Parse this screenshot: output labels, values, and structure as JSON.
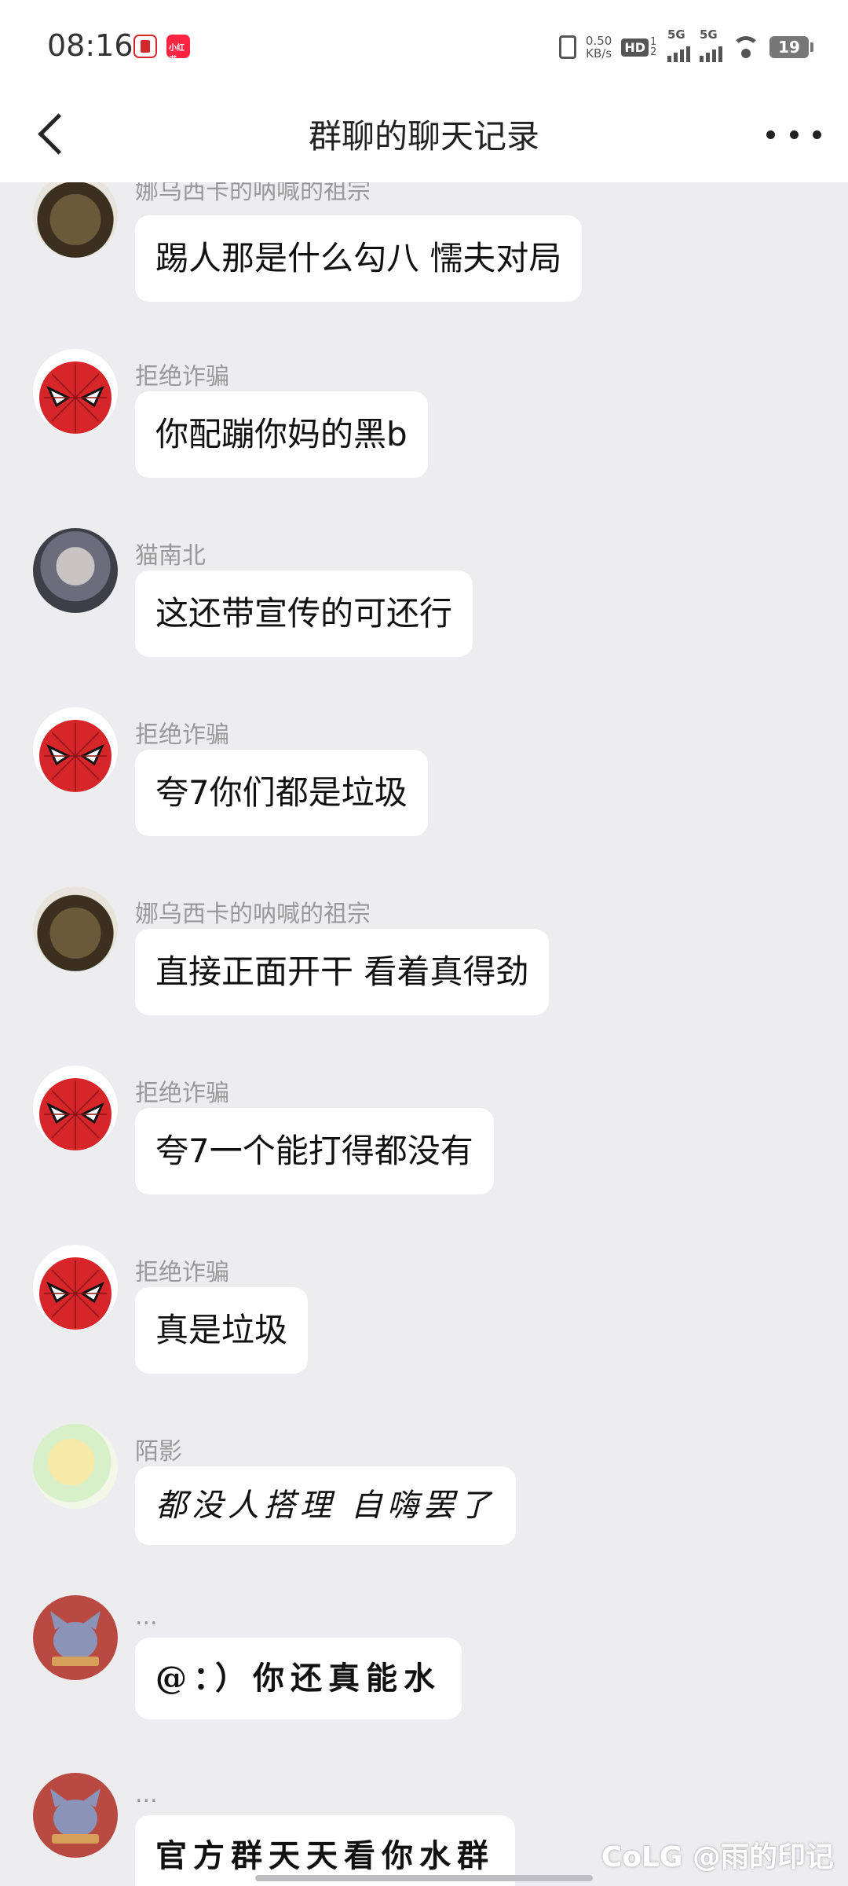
{
  "status": {
    "time": "08:16",
    "net_speed": "0.50",
    "net_unit": "KB/s",
    "hd": "HD",
    "hd_sub": "1 2",
    "sig1": "5G",
    "sig2": "5G",
    "battery": "19",
    "app2_label": "小红书"
  },
  "header": {
    "title": "群聊的聊天记录"
  },
  "messages": [
    {
      "sender": "娜乌西卡的呐喊的祖宗",
      "text": "踢人那是什么勾八  懦夫对局"
    },
    {
      "sender": "拒绝诈骗",
      "text": "你配蹦你妈的黑b"
    },
    {
      "sender": "猫南北",
      "text": "这还带宣传的可还行"
    },
    {
      "sender": "拒绝诈骗",
      "text": "夸7你们都是垃圾"
    },
    {
      "sender": "娜乌西卡的呐喊的祖宗",
      "text": "直接正面开干  看着真得劲"
    },
    {
      "sender": "拒绝诈骗",
      "text": "夸7一个能打得都没有"
    },
    {
      "sender": "拒绝诈骗",
      "text": "真是垃圾"
    },
    {
      "sender": "陌影",
      "text": "都没人搭理 自嗨罢了"
    },
    {
      "sender": "...",
      "text": "@：）你还真能水"
    },
    {
      "sender": "...",
      "text": "官方群天天看你水群"
    }
  ],
  "watermark": "CoLG @雨的印记"
}
